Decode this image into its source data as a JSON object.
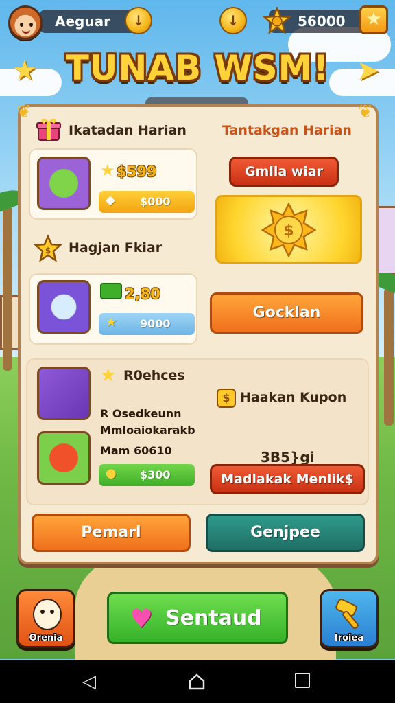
{
  "hud": {
    "player_name": "Aeguar",
    "center_coin_glyph": "↓",
    "gold_amount": "56000",
    "icons": [
      "player-avatar-icon",
      "coin-down-icon",
      "coin-icon",
      "gold-star-badge-icon",
      "star-icon"
    ]
  },
  "title": "TUNAB WSM!",
  "panel": {
    "left_heading": "Ikatadan Harian",
    "right_heading": "Tantakgan Harian",
    "task1": {
      "reward_big": "$599",
      "reward_small": "$000"
    },
    "task1_button": "Gmlla wiar",
    "section2_heading": "Hagjan Fkiar",
    "task2": {
      "reward_big": "2,80",
      "reward_small": "9000"
    },
    "task2_button": "Gocklan",
    "section3_heading": "R0ehces",
    "section3_lines": [
      "R Osedkeunn",
      "Mmloaiokarakb",
      "Mam 60610"
    ],
    "task3": {
      "reward_small": "$300"
    },
    "kupon_heading": "Haakan Kupon",
    "kupon_code": "3B5}gi",
    "kupon_button": "Madlakak Menlik$",
    "bottom_left_button": "Pemarl",
    "bottom_right_button": "Genjpee"
  },
  "bottom": {
    "left_label": "Orenia",
    "main_button": "Sentaud",
    "right_label": "Iroiea"
  },
  "colors": {
    "panel_bg": "#f7ead3",
    "title_fill": "#ffd23a",
    "button_red": "#d8401f",
    "button_orange": "#f58a26",
    "button_teal": "#278478",
    "button_green": "#4fc83a"
  }
}
